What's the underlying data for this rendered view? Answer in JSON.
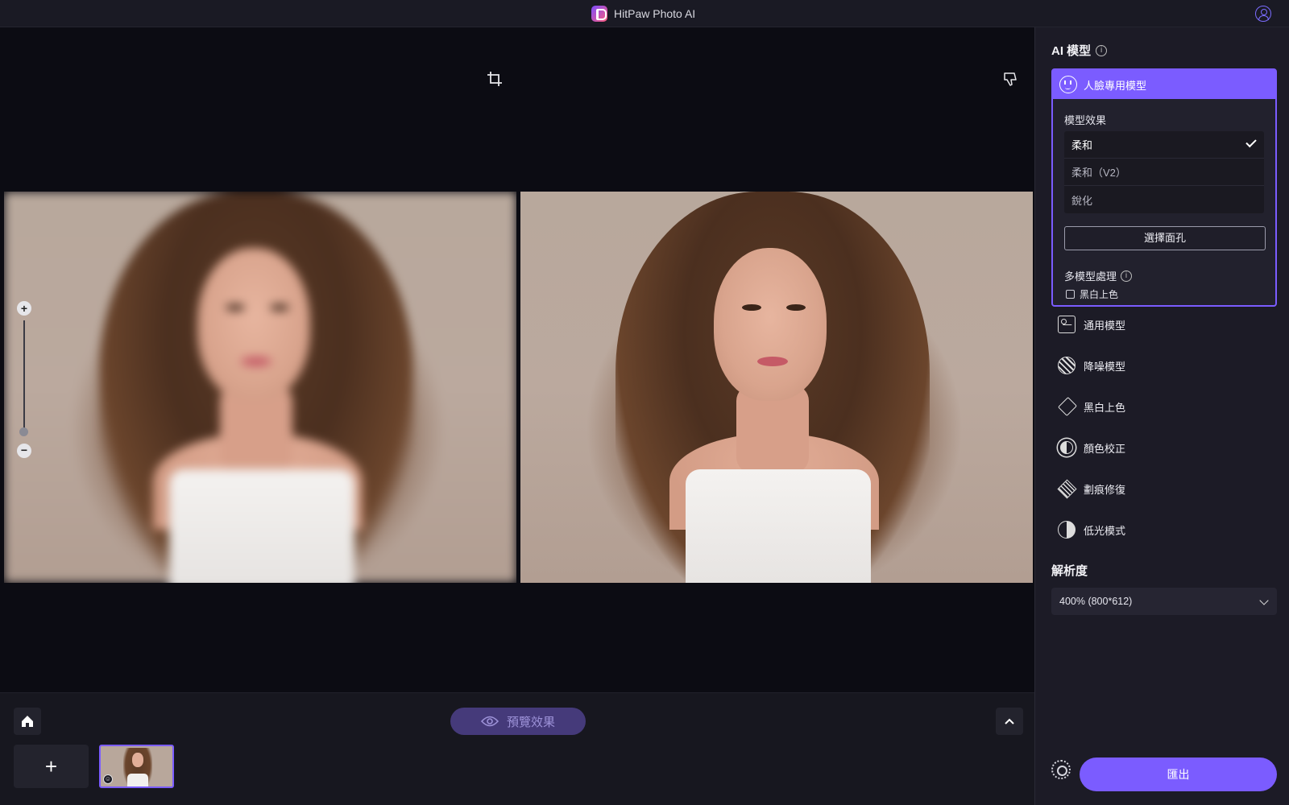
{
  "titlebar": {
    "app_name": "HitPaw Photo AI"
  },
  "canvas": {
    "zoom_plus": "+",
    "zoom_minus": "−",
    "zoom_level": 0.05
  },
  "bottombar": {
    "preview_label": "預覽效果",
    "add_label": "+"
  },
  "sidepanel": {
    "title": "AI 模型",
    "face_model": {
      "name": "人臉專用模型",
      "effect_label": "模型效果",
      "options": [
        "柔和",
        "柔和（V2）",
        "銳化"
      ],
      "selected": "柔和",
      "select_face_label": "選擇面孔",
      "multi_label": "多模型處理",
      "checkbox_label": "黑白上色",
      "checkbox_checked": false
    },
    "models": [
      {
        "label": "通用模型",
        "icon": "general-model-icon"
      },
      {
        "label": "降噪模型",
        "icon": "denoise-model-icon"
      },
      {
        "label": "黑白上色",
        "icon": "colorize-model-icon"
      },
      {
        "label": "顏色校正",
        "icon": "color-correction-icon"
      },
      {
        "label": "劃痕修復",
        "icon": "scratch-repair-icon"
      },
      {
        "label": "低光模式",
        "icon": "low-light-icon"
      }
    ],
    "resolution_title": "解析度",
    "resolution_value": "400% (800*612)",
    "export_label": "匯出"
  },
  "colors": {
    "accent": "#7b5cff",
    "panel": "#1c1b26",
    "canvas": "#0c0c13"
  }
}
